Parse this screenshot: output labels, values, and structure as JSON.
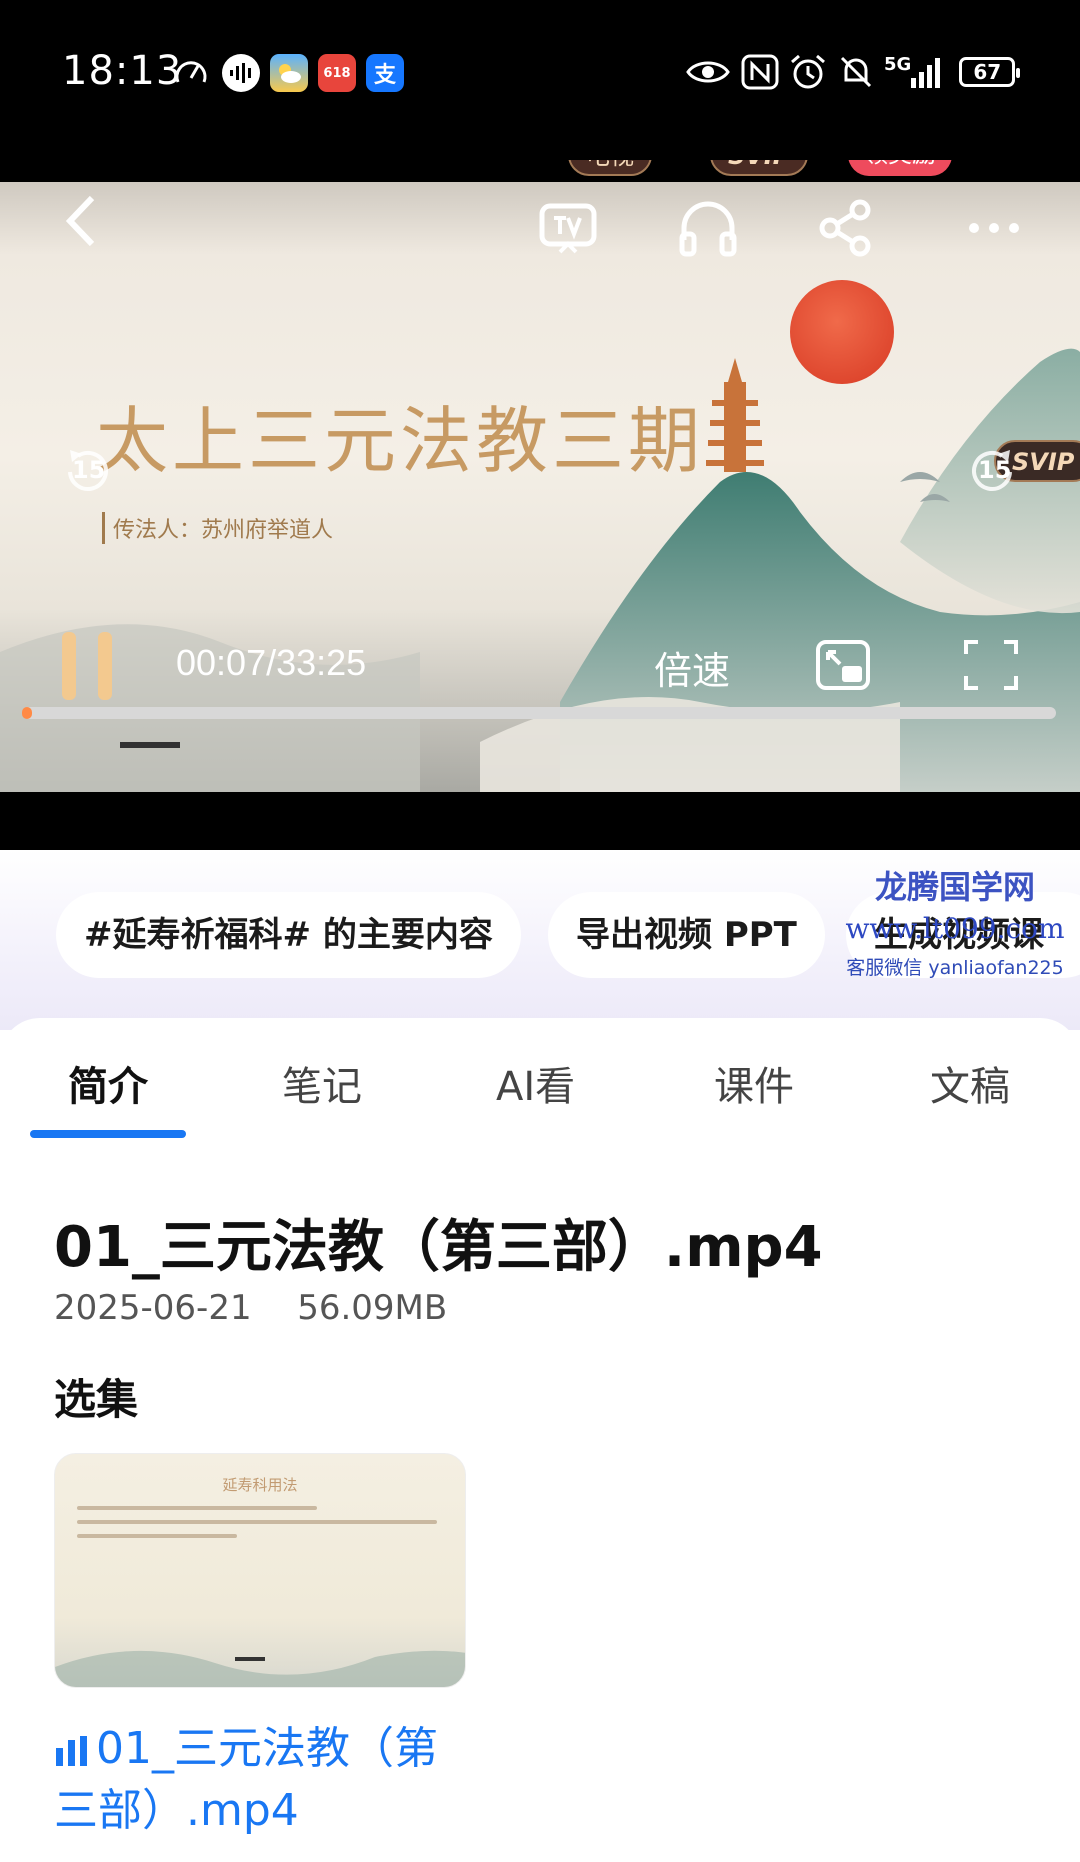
{
  "status_bar": {
    "time": "18:13",
    "network": "5G",
    "battery": "67"
  },
  "player": {
    "badges": {
      "tv": "电视",
      "audio": "SVIP",
      "share": "领奖励",
      "side": "SVIP"
    },
    "slide": {
      "title": "太上三元法教三期",
      "subtitle": "传法人：苏州府举道人"
    },
    "seek_back": "15",
    "seek_forward": "15",
    "time": "00:07/33:25",
    "speed_label": "倍速",
    "progress": 0.0035
  },
  "actions": {
    "chips": [
      "#延寿祈福科# 的主要内容",
      "导出视频 PPT",
      "生成视频课"
    ]
  },
  "watermark": {
    "title": "龙腾国学网",
    "url": "www.lt099.com",
    "wechat": "客服微信 yanliaofan225"
  },
  "tabs": [
    "简介",
    "笔记",
    "AI看",
    "课件",
    "文稿"
  ],
  "file": {
    "title": "01_三元法教（第三部）.mp4",
    "date": "2025-06-21",
    "size": "56.09MB"
  },
  "episodes": {
    "section_title": "选集",
    "items": [
      {
        "thumb_title": "延寿科用法",
        "name": "01_三元法教（第三部）.mp4"
      }
    ]
  },
  "colors": {
    "accent": "#1977f3",
    "progress": "#ff8a46",
    "slide_title": "#c79a63"
  }
}
